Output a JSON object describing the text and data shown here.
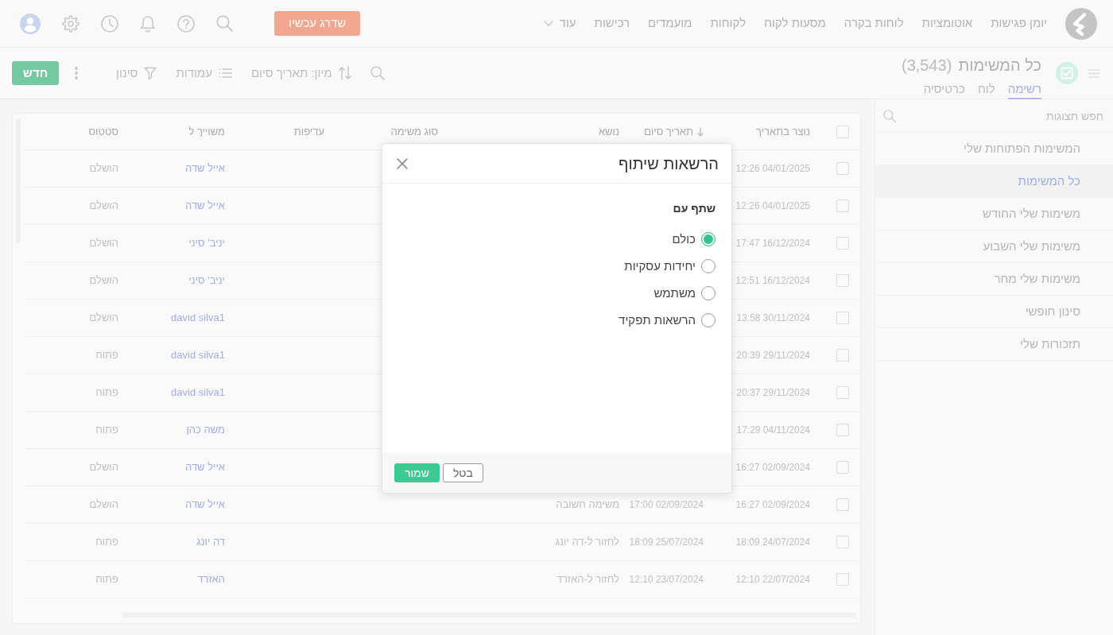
{
  "top_nav": {
    "links": [
      {
        "label": "יומן פגישות"
      },
      {
        "label": "אוטומציות"
      },
      {
        "label": "לוחות בקרה"
      },
      {
        "label": "מסעות לקוח"
      },
      {
        "label": "לקוחות"
      },
      {
        "label": "מועמדים"
      },
      {
        "label": "רכישות"
      }
    ],
    "more_menu": {
      "label": "עוד"
    },
    "upgrade_button": {
      "label": "שדרג עכשיו"
    }
  },
  "page_header": {
    "title": "כל המשימות",
    "count": "(3,543)",
    "view_tabs": [
      {
        "label": "רשימה",
        "selected": true
      },
      {
        "label": "לוח",
        "selected": false
      },
      {
        "label": "כרטיסיה",
        "selected": false
      }
    ]
  },
  "toolbar": {
    "sort_button": {
      "label": "מיון: תאריך סיום"
    },
    "columns_button": {
      "label": "עמודות"
    },
    "filter_button": {
      "label": "סינון"
    },
    "new_button": {
      "label": "חדש"
    }
  },
  "sidebar": {
    "search": {
      "placeholder": "חפש תצוגות"
    },
    "items": [
      {
        "label": "המשימות הפתוחות שלי",
        "selected": false
      },
      {
        "label": "כל המשימות",
        "selected": true
      },
      {
        "label": "משימות שלי החודש",
        "selected": false
      },
      {
        "label": "משימות שלי השבוע",
        "selected": false
      },
      {
        "label": "משימות שלי מחר",
        "selected": false
      },
      {
        "label": "סינון חופשי",
        "selected": false
      },
      {
        "label": "תזכורות שלי",
        "selected": false
      }
    ]
  },
  "table": {
    "select_all_checked": false,
    "columns": [
      {
        "label": "נוצר בתאריך",
        "kind": "date",
        "sorted": false
      },
      {
        "label": "תאריך סיום",
        "kind": "date",
        "sorted": true
      },
      {
        "label": "נושא",
        "kind": "text",
        "sorted": false
      },
      {
        "label": "סוג משימה",
        "sorted": false
      },
      {
        "label": "עדיפות",
        "sorted": false
      },
      {
        "label": "משוייך ל",
        "kind": "link",
        "sorted": false
      },
      {
        "label": "סטטוס",
        "kind": "text",
        "sorted": false
      }
    ],
    "rows": [
      {
        "checked": false,
        "created_date": "12:26 04/01/2025",
        "assigned_to": "אייל שדה",
        "status": "הושלם"
      },
      {
        "checked": false,
        "created_date": "12:26 04/01/2025",
        "assigned_to": "אייל שדה",
        "status": "הושלם"
      },
      {
        "checked": false,
        "created_date": "17:47 16/12/2024",
        "assigned_to": "יניב' סיני",
        "status": "הושלם"
      },
      {
        "checked": false,
        "created_date": "12:51 16/12/2024",
        "assigned_to": "יניב' סיני",
        "status": "הושלם"
      },
      {
        "checked": false,
        "created_date": "13:58 30/11/2024",
        "assigned_to": "david silva1",
        "status": "הושלם"
      },
      {
        "checked": false,
        "created_date": "20:39 29/11/2024",
        "assigned_to": "david silva1",
        "status": "פתוח"
      },
      {
        "checked": false,
        "created_date": "20:37 29/11/2024",
        "assigned_to": "david silva1",
        "status": "פתוח"
      },
      {
        "checked": false,
        "created_date": "17:29 04/11/2024",
        "assigned_to": "משה כהן",
        "status": "פתוח"
      },
      {
        "checked": false,
        "created_date": "16:27 02/09/2024",
        "assigned_to": "אייל שדה",
        "status": "הושלם"
      },
      {
        "checked": false,
        "created_date": "16:27 02/09/2024",
        "due_date": "17:00 02/09/2024",
        "subject": "משימה חשובה",
        "assigned_to": "אייל שדה",
        "status": "הושלם"
      },
      {
        "checked": false,
        "created_date": "18:09 24/07/2024",
        "due_date": "18:09 25/07/2024",
        "subject": "לחזור ל-דה יונג",
        "assigned_to": "דה יונג",
        "status": "פתוח"
      },
      {
        "checked": false,
        "created_date": "12:10 22/07/2024",
        "due_date": "12:10 23/07/2024",
        "subject": "לחזור ל-האזרד",
        "assigned_to": "האזרד",
        "status": "פתוח"
      }
    ]
  },
  "share_dialog": {
    "title": "הרשאות שיתוף",
    "section_label": "שתף עם",
    "options": [
      {
        "label": "כולם",
        "selected": true
      },
      {
        "label": "יחידות עסקיות",
        "selected": false
      },
      {
        "label": "משתמש",
        "selected": false
      },
      {
        "label": "הרשאות תפקיד",
        "selected": false
      }
    ],
    "buttons": [
      {
        "label": "בטל",
        "kind": "secondary"
      },
      {
        "label": "שמור",
        "kind": "primary"
      }
    ]
  }
}
